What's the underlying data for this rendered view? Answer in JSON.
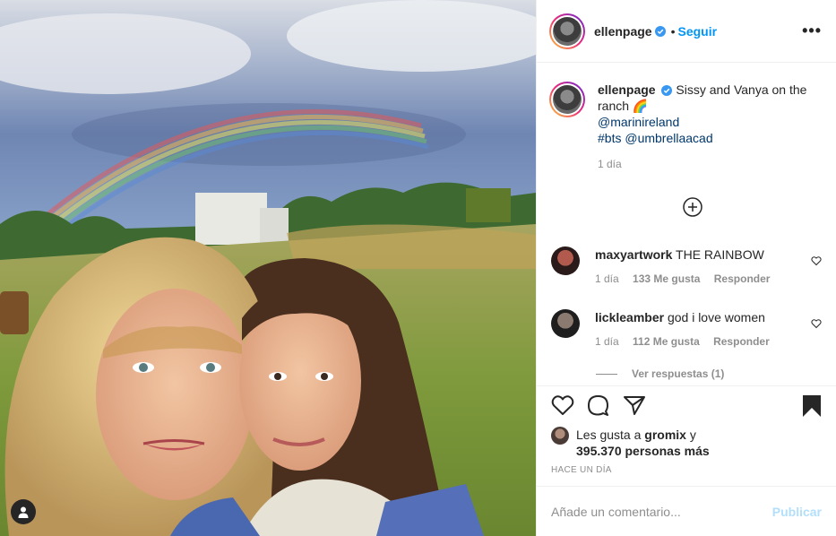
{
  "post": {
    "author": "ellenpage",
    "follow_label": "Seguir",
    "dot": "•",
    "more_label": "•••",
    "caption_text": "Sissy and Vanya on the ranch",
    "caption_emoji": "🌈",
    "mention_1": "@marinireland",
    "hashtag": "#bts",
    "mention_2": "@umbrellaacad",
    "caption_time": "1 día"
  },
  "comments": [
    {
      "user": "maxyartwork",
      "text": "THE RAINBOW",
      "time": "1 día",
      "likes": "133 Me gusta",
      "reply": "Responder"
    },
    {
      "user": "lickleamber",
      "text": "god i love women",
      "time": "1 día",
      "likes": "112 Me gusta",
      "reply": "Responder"
    }
  ],
  "view_replies": "Ver respuestas (1)",
  "likes": {
    "prefix": "Les gusta a",
    "user": "gromix",
    "suffix": "y",
    "count": "395.370 personas más"
  },
  "time_ago": "HACE UN DÍA",
  "add_comment": {
    "placeholder": "Añade un comentario...",
    "publish_label": "Publicar"
  },
  "icons": {
    "verified": "verified-badge-icon",
    "heart": "heart-icon",
    "comment": "comment-icon",
    "share": "paper-plane-icon",
    "save": "bookmark-icon",
    "tag": "user-tag-icon",
    "plus": "plus-circle-icon"
  },
  "colors": {
    "accent_blue": "#0095f6",
    "verified_blue": "#3897f0",
    "mention_blue": "#00376b",
    "publish_disabled": "#b2dffc",
    "muted": "#8e8e8e"
  }
}
